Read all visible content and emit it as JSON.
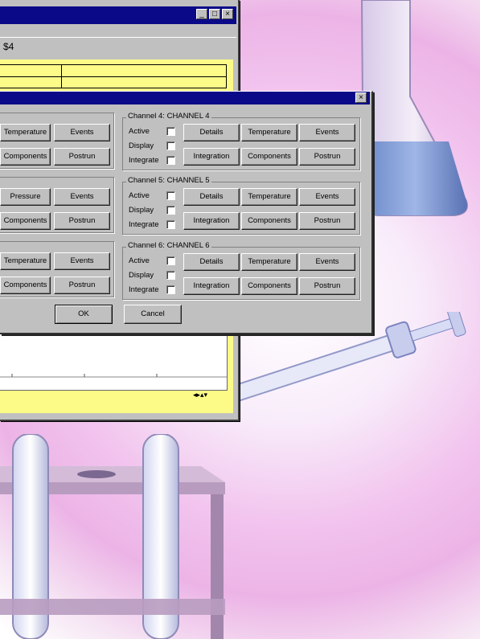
{
  "back_window": {
    "toolbar_icon_label": "$4",
    "window_buttons": {
      "minimize": "_",
      "maximize": "□",
      "close": "×"
    }
  },
  "dialog": {
    "close_glyph": "×",
    "left_partial_rows": [
      {
        "row": 1,
        "buttons": [
          "Temperature",
          "Events"
        ]
      },
      {
        "row": 2,
        "buttons": [
          "Components",
          "Postrun"
        ]
      },
      {
        "row": 3,
        "buttons": [
          "Pressure",
          "Events"
        ]
      },
      {
        "row": 4,
        "buttons": [
          "Components",
          "Postrun"
        ]
      },
      {
        "row": 5,
        "buttons": [
          "Temperature",
          "Events"
        ]
      },
      {
        "row": 6,
        "buttons": [
          "Components",
          "Postrun"
        ]
      }
    ],
    "channels": [
      {
        "label": "Channel 4: CHANNEL 4",
        "active": "Active",
        "display": "Display",
        "integrate": "Integrate",
        "buttons_row1": [
          "Details",
          "Temperature",
          "Events"
        ],
        "buttons_row2": [
          "Integration",
          "Components",
          "Postrun"
        ]
      },
      {
        "label": "Channel 5: CHANNEL 5",
        "active": "Active",
        "display": "Display",
        "integrate": "Integrate",
        "buttons_row1": [
          "Details",
          "Temperature",
          "Events"
        ],
        "buttons_row2": [
          "Integration",
          "Components",
          "Postrun"
        ]
      },
      {
        "label": "Channel 6: CHANNEL 6",
        "active": "Active",
        "display": "Display",
        "integrate": "Integrate",
        "buttons_row1": [
          "Details",
          "Temperature",
          "Events"
        ],
        "buttons_row2": [
          "Integration",
          "Components",
          "Postrun"
        ]
      }
    ],
    "ok_label": "OK",
    "cancel_label": "Cancel"
  },
  "colors": {
    "titlebar": "#0a0a88",
    "window_face": "#c0c0c0",
    "yellow_panel": "#fdfb88"
  }
}
